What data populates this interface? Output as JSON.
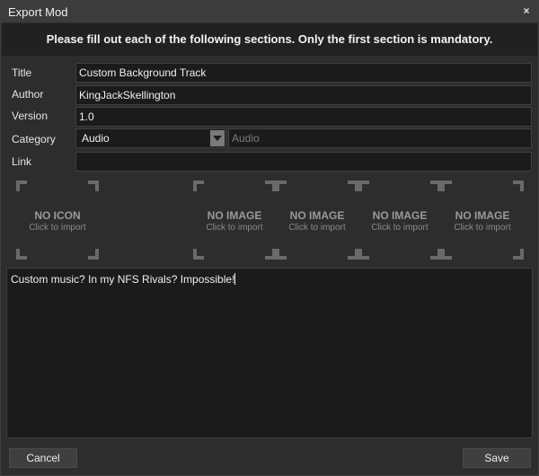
{
  "window": {
    "title": "Export Mod",
    "close_label": "×"
  },
  "header": {
    "text": "Please fill out each of the following sections. Only the first section is mandatory."
  },
  "fields": {
    "title_label": "Title",
    "title_value": "Custom Background Track",
    "author_label": "Author",
    "author_value": "KingJackSkellington",
    "version_label": "Version",
    "version_value": "1.0",
    "category_label": "Category",
    "category_selected": "Audio",
    "category_custom_placeholder": "Audio",
    "link_label": "Link",
    "link_value": ""
  },
  "slots": [
    {
      "title": "NO ICON",
      "subtitle": "Click to import"
    },
    {
      "title": "NO IMAGE",
      "subtitle": "Click to import"
    },
    {
      "title": "NO IMAGE",
      "subtitle": "Click to import"
    },
    {
      "title": "NO IMAGE",
      "subtitle": "Click to import"
    },
    {
      "title": "NO IMAGE",
      "subtitle": "Click to import"
    }
  ],
  "description": {
    "text": "Custom music? In my NFS Rivals? Impossible!"
  },
  "footer": {
    "cancel_label": "Cancel",
    "save_label": "Save"
  }
}
